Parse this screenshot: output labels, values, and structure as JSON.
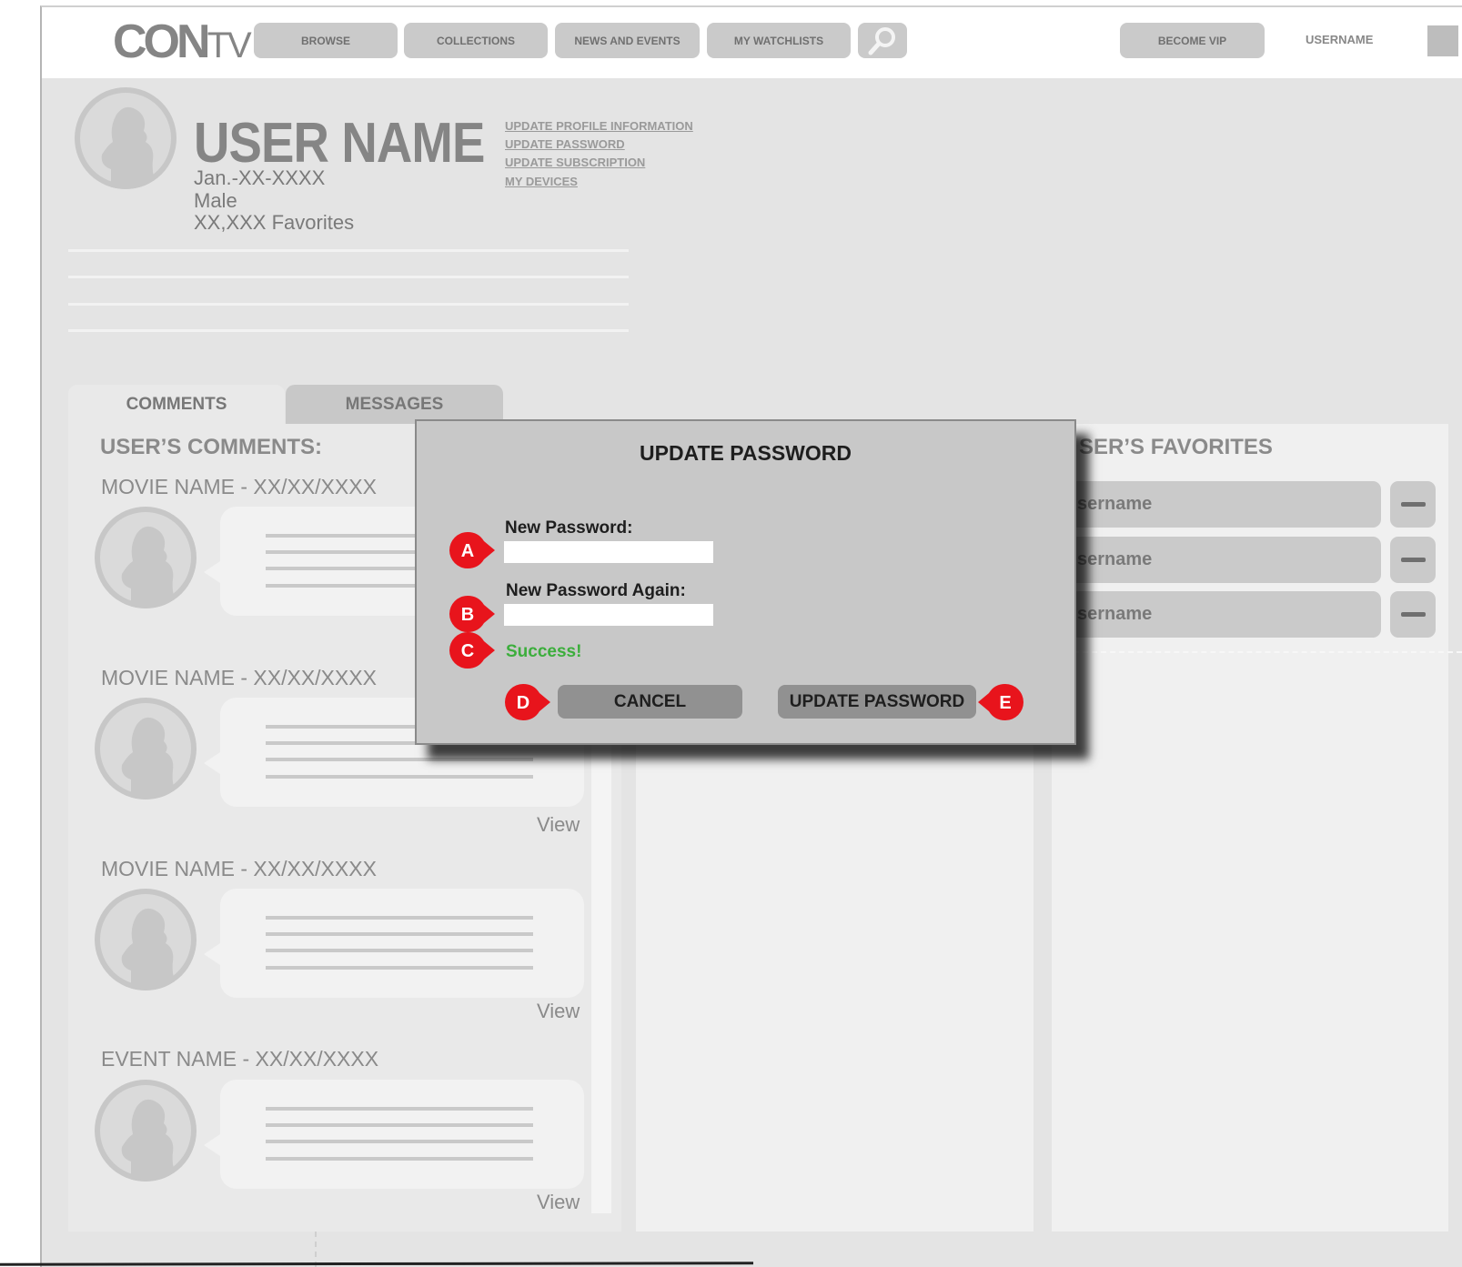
{
  "header": {
    "logo_main": "CON",
    "logo_sub": "TV",
    "nav": [
      "BROWSE",
      "COLLECTIONS",
      "NEWS AND EVENTS",
      "MY WATCHLISTS"
    ],
    "become_vip": "BECOME VIP",
    "username": "USERNAME"
  },
  "profile": {
    "name": "USER NAME",
    "dob": "Jan.-XX-XXXX",
    "gender": "Male",
    "favorites_count": "XX,XXX Favorites",
    "links": [
      "UPDATE PROFILE INFORMATION",
      "UPDATE PASSWORD",
      "UPDATE SUBSCRIPTION",
      "MY DEVICES"
    ]
  },
  "tabs": [
    "COMMENTS",
    "MESSAGES"
  ],
  "comments": {
    "title": "USER’S COMMENTS:",
    "items": [
      {
        "name": "MOVIE NAME - XX/XX/XXXX"
      },
      {
        "name": "MOVIE NAME - XX/XX/XXXX",
        "view": "View"
      },
      {
        "name": "MOVIE NAME - XX/XX/XXXX",
        "view": "View"
      },
      {
        "name": "EVENT NAME - XX/XX/XXXX",
        "view": "View"
      }
    ]
  },
  "favorites": {
    "title": "SER’S FAVORITES",
    "items": [
      "sername",
      "sername",
      "sername"
    ]
  },
  "modal": {
    "title": "UPDATE PASSWORD",
    "new_password_label": "New Password:",
    "new_password_again_label": "New Password Again:",
    "success": "Success!",
    "cancel": "CANCEL",
    "update": "UPDATE PASSWORD",
    "callouts": [
      "A",
      "B",
      "C",
      "D",
      "E"
    ]
  },
  "colors": {
    "accent_red": "#e8141c",
    "success_green": "#3cae3c"
  }
}
